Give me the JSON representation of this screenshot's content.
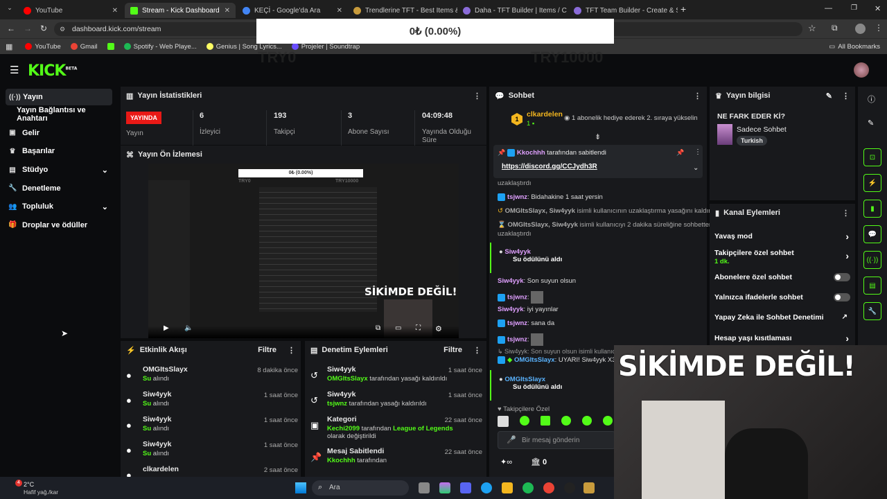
{
  "browser": {
    "tabs": [
      {
        "title": "YouTube",
        "color": "#ff0000"
      },
      {
        "title": "Stream - Kick Dashboard",
        "color": "#53fc18"
      },
      {
        "title": "KEÇİ - Google'da Ara",
        "color": "#4285f4"
      },
      {
        "title": "Trendlerine TFT - Best Items &",
        "color": "#c89b3c"
      },
      {
        "title": "Daha - TFT Builder | Items / C",
        "color": "#8a6bd8"
      },
      {
        "title": "TFT Team Builder - Create & Sh",
        "color": "#8a6bd8"
      }
    ],
    "url": "dashboard.kick.com/stream",
    "bookmarks": [
      "YouTube",
      "Gmail",
      "",
      "Spotify - Web Playe...",
      "Genius | Song Lyrics...",
      "Projeler | Soundtrap"
    ],
    "all_bookmarks": "All Bookmarks"
  },
  "overlay": {
    "value": "0₺ (0.00%)",
    "left": "TRY0",
    "right": "TRY10000"
  },
  "header": {
    "logo": "KICK",
    "beta": "BETA"
  },
  "sidebar": {
    "items": [
      {
        "label": "Yayın",
        "icon": "broadcast-icon"
      },
      {
        "label": "Yayın Bağlantısı ve Anahtarı",
        "icon": ""
      },
      {
        "label": "Gelir",
        "icon": "revenue-icon"
      },
      {
        "label": "Başarılar",
        "icon": "trophy-icon"
      },
      {
        "label": "Stüdyo",
        "icon": "studio-icon"
      },
      {
        "label": "Denetleme",
        "icon": "wrench-icon"
      },
      {
        "label": "Topluluk",
        "icon": "community-icon"
      },
      {
        "label": "Droplar ve ödüller",
        "icon": "gift-icon"
      }
    ]
  },
  "stats": {
    "title": "Yayın İstatistikleri",
    "live": "YAYINDA",
    "live_label": "Yayın",
    "items": [
      {
        "value": "6",
        "label": "İzleyici"
      },
      {
        "value": "193",
        "label": "Takipçi"
      },
      {
        "value": "3",
        "label": "Abone Sayısı"
      },
      {
        "value": "04:09:48",
        "label": "Yayında Olduğu Süre"
      }
    ]
  },
  "preview": {
    "title": "Yayın Ön İzlemesi",
    "caption": "SİKİMDE DEĞİL!",
    "mini_overlay": "0₺ (0.00%)",
    "mini_left": "TRY0",
    "mini_right": "TRY10000"
  },
  "events": {
    "title": "Etkinlik Akışı",
    "filter": "Filtre",
    "rows": [
      {
        "name": "OMGItsSlayx",
        "sub": "Su",
        "action": "alındı",
        "time": "8 dakika önce"
      },
      {
        "name": "Siw4yyk",
        "sub": "Su",
        "action": "alındı",
        "time": "1 saat önce"
      },
      {
        "name": "Siw4yyk",
        "sub": "Su",
        "action": "alındı",
        "time": "1 saat önce"
      },
      {
        "name": "Siw4yyk",
        "sub": "Su",
        "action": "alındı",
        "time": "1 saat önce"
      },
      {
        "name": "clkardelen",
        "sub": "",
        "action": "",
        "time": "2 saat önce"
      }
    ]
  },
  "mod": {
    "title": "Denetim Eylemleri",
    "filter": "Filtre",
    "rows": [
      {
        "name": "Siw4yyk",
        "who": "OMGItsSlayx",
        "rest": "tarafından yasağı kaldırıldı",
        "time": "1 saat önce"
      },
      {
        "name": "Siw4yyk",
        "who": "tsjwnz",
        "rest": "tarafından yasağı kaldırıldı",
        "time": "1 saat önce"
      },
      {
        "name": "Kategori",
        "who": "Kechi2099",
        "rest": "tarafından",
        "extra": "League of Legends",
        "rest2": "olarak değiştirildi",
        "time": "22 saat önce"
      },
      {
        "name": "Mesaj Sabitlendi",
        "who": "Kkochhh",
        "rest": "tarafından",
        "time": "22 saat önce"
      }
    ]
  },
  "chat": {
    "title": "Sohbet",
    "top_user": "clkardelen",
    "top_count": "1",
    "top_rank": "1",
    "gift_text": "1 abonelik hediye ederek 2. sıraya yükselin",
    "pinned_by": "Kkochhh",
    "pinned_suffix": "tarafından sabitlendi",
    "pinned_link": "https://discord.gg/CCJydh3R",
    "lines": [
      {
        "text": "uzaklaştırdı"
      },
      {
        "user": "tsjwnz",
        "text": "Bidahakine 1 saat yersin"
      },
      {
        "user": "OMGItsSlayx, Siw4yyk",
        "text": "isimli kullanıcının uzaklaştırma yasağını kaldırdı"
      },
      {
        "user": "OMGItsSlayx, Siw4yyk",
        "text": "isimli kullanıcıyı 2 dakika süreliğine sohbetten"
      },
      {
        "text": "uzaklaştırdı"
      },
      {
        "user": "Siw4yyk",
        "text": "Su ödülünü aldı"
      },
      {
        "user": "Siw4yyk",
        "text": "Son suyun olsun"
      },
      {
        "user": "tsjwnz",
        "text": ""
      },
      {
        "user": "Siw4yyk",
        "text": "iyi yayınlar"
      },
      {
        "user": "tsjwnz",
        "text": "sana da"
      },
      {
        "user": "tsjwnz",
        "text": ""
      },
      {
        "text": "Siw4yyk: Son suyun olsun isimli kullanıcı"
      },
      {
        "user": "OMGItsSlayx",
        "text": "UYARI! Siw4yyk X3"
      },
      {
        "user": "OMGItsSlayx",
        "text": "Su ödülünü aldı"
      }
    ],
    "followers_only": "Takipçilere Özel",
    "placeholder": "Bir mesaj gönderin",
    "points": "0"
  },
  "info": {
    "title": "Yayın bilgisi",
    "stream_title": "NE FARK EDER Kİ?",
    "category": "Sadece Sohbet",
    "tag": "Turkish"
  },
  "channel": {
    "title": "Kanal Eylemleri",
    "rows": [
      {
        "label": "Yavaş mod",
        "sub": "",
        "type": "arrow"
      },
      {
        "label": "Takipçilere özel sohbet",
        "sub": "1 dk.",
        "type": "arrow"
      },
      {
        "label": "Abonelere özel sohbet",
        "sub": "",
        "type": "toggle"
      },
      {
        "label": "Yalnızca ifadelerle sohbet",
        "sub": "",
        "type": "toggle"
      },
      {
        "label": "Yapay Zeka ile Sohbet Denetimi",
        "sub": "",
        "type": "ext"
      },
      {
        "label": "Hesap yaşı kısıtlaması",
        "sub": "",
        "type": "arrow"
      }
    ]
  },
  "webcam": {
    "caption": "SİKİMDE DEĞİL!"
  },
  "taskbar": {
    "weather_temp": "2°C",
    "weather_desc": "Hafif yağ./kar",
    "search": "Ara",
    "notif": "4"
  }
}
